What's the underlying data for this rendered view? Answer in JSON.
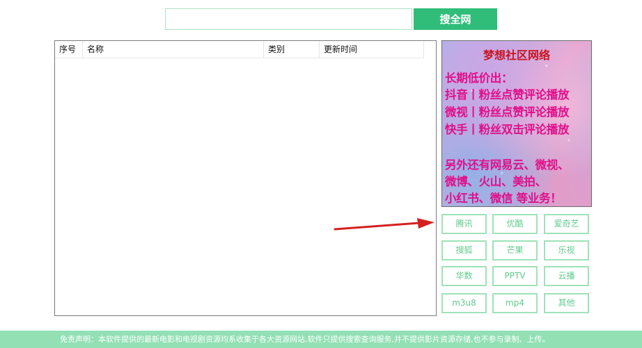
{
  "search": {
    "input_value": "",
    "button_label": "搜全网"
  },
  "table": {
    "columns": [
      "序号",
      "名称",
      "类别",
      "更新时间"
    ],
    "rows": []
  },
  "ad": {
    "title": "梦想社区网络",
    "lines": [
      "长期低价出：",
      "抖音丨粉丝点赞评论播放",
      "微视丨粉丝点赞评论播放",
      "快手丨粉丝双击评论播放",
      "另外还有网易云、微视、",
      "微博、火山、美拍、",
      "小红书、微信 等业务！"
    ]
  },
  "sources": {
    "buttons": [
      "腾讯",
      "优酷",
      "爱奇艺",
      "搜狐",
      "芒果",
      "乐视",
      "华数",
      "PPTV",
      "云播",
      "m3u8",
      "mp4",
      "其他"
    ]
  },
  "footer": {
    "text": "免责声明：本软件提供的最新电影和电视剧资源均系收集于各大资源网站,软件只提供搜索查询服务,并不提供影片资源存储,也不参与录制、上传。"
  },
  "colors": {
    "accent": "#2fbd79",
    "button_border": "#9ee2b8",
    "footer_bg": "#92e0b4",
    "ad_text": "#e0108a",
    "ad_title": "#c8141f",
    "arrow": "#d42020"
  }
}
